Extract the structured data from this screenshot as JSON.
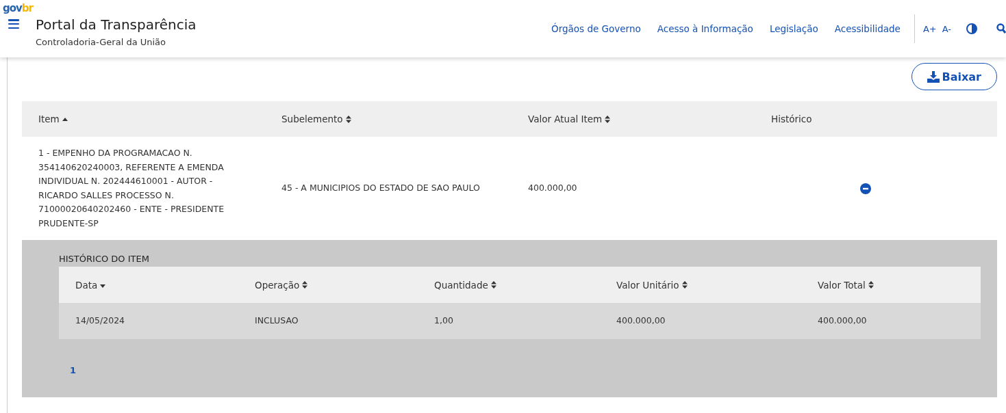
{
  "header": {
    "logo": [
      "gov",
      "br"
    ],
    "title": "Portal da Transparência",
    "subtitle": "Controladoria-Geral da União",
    "nav": [
      "Órgãos de Governo",
      "Acesso à Informação",
      "Legislação",
      "Acessibilidade"
    ],
    "font_buttons": [
      "A+",
      "A-"
    ]
  },
  "download_button": "Baixar",
  "table": {
    "columns": [
      {
        "label": "Item",
        "sort_up": true,
        "sort_down": false
      },
      {
        "label": "Subelemento",
        "sort_up": true,
        "sort_down": true
      },
      {
        "label": "Valor Atual Item",
        "sort_up": true,
        "sort_down": true
      },
      {
        "label": "Histórico",
        "sort_up": false,
        "sort_down": false
      }
    ],
    "rows": [
      {
        "item": "1 - EMPENHO DA PROGRAMACAO N. 354140620240003, REFERENTE A EMENDA INDIVIDUAL N. 202444610001 - AUTOR - RICARDO SALLES PROCESSO N. 71000020640202460 - ENTE - PRESIDENTE PRUDENTE-SP",
        "subelemento": "45 - A MUNICIPIOS DO ESTADO DE SAO PAULO",
        "valor": "400.000,00",
        "expanded": true,
        "history": {
          "title": "HISTÓRICO DO ITEM",
          "columns": [
            {
              "label": "Data",
              "sort_up": false,
              "sort_down": true
            },
            {
              "label": "Operação",
              "sort_up": true,
              "sort_down": true
            },
            {
              "label": "Quantidade",
              "sort_up": true,
              "sort_down": true
            },
            {
              "label": "Valor Unitário",
              "sort_up": true,
              "sort_down": true
            },
            {
              "label": "Valor Total",
              "sort_up": true,
              "sort_down": true
            }
          ],
          "rows": [
            [
              "14/05/2024",
              "INCLUSAO",
              "1,00",
              "400.000,00",
              "400.000,00"
            ]
          ],
          "pages": [
            {
              "label": "1",
              "selected": true
            }
          ]
        }
      }
    ]
  }
}
